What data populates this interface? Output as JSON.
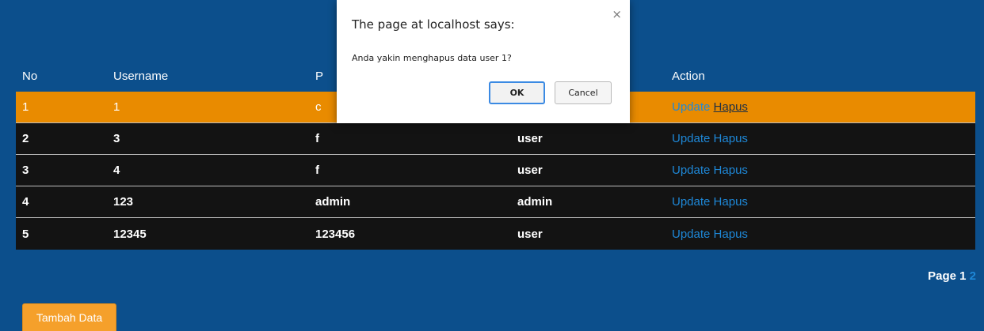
{
  "table": {
    "headers": [
      "No",
      "Username",
      "P",
      "",
      "Action"
    ],
    "rows": [
      {
        "no": "1",
        "username": "1",
        "password": "c",
        "level": "",
        "update": "Update",
        "delete": "Hapus"
      },
      {
        "no": "2",
        "username": "3",
        "password": "f",
        "level": "user",
        "update": "Update",
        "delete": "Hapus"
      },
      {
        "no": "3",
        "username": "4",
        "password": "f",
        "level": "user",
        "update": "Update",
        "delete": "Hapus"
      },
      {
        "no": "4",
        "username": "123",
        "password": "admin",
        "level": "admin",
        "update": "Update",
        "delete": "Hapus"
      },
      {
        "no": "5",
        "username": "12345",
        "password": "123456",
        "level": "user",
        "update": "Update",
        "delete": "Hapus"
      }
    ]
  },
  "pagination": {
    "label": "Page",
    "current": "1",
    "next": "2"
  },
  "add_button": "Tambah Data",
  "dialog": {
    "title": "The page at localhost says:",
    "message": "Anda yakin menghapus data user 1?",
    "ok": "OK",
    "cancel": "Cancel",
    "close": "×"
  },
  "colors": {
    "background": "#0c4f8c",
    "row_dark": "#131313",
    "row_highlight": "#e98b00",
    "link": "#1e88d8",
    "button": "#f5a02b"
  }
}
